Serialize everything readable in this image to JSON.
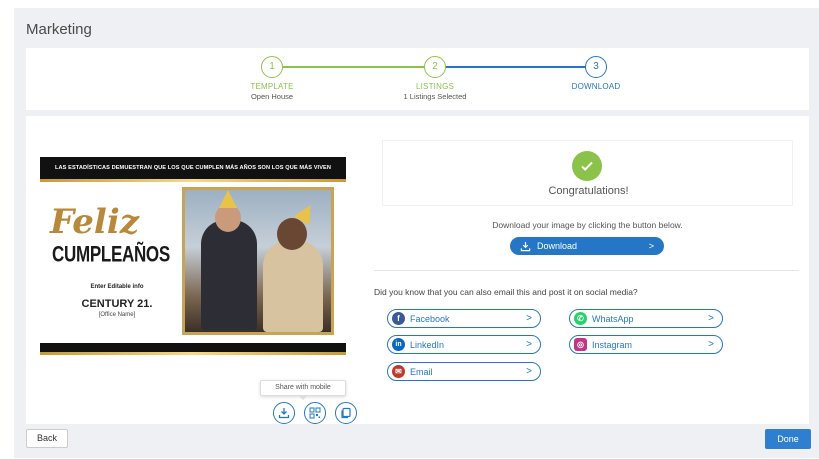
{
  "page": {
    "title": "Marketing"
  },
  "stepper": {
    "steps": [
      {
        "number": "1",
        "label": "TEMPLATE",
        "sub": "Open House"
      },
      {
        "number": "2",
        "label": "LISTINGS",
        "sub": "1 Listings Selected"
      },
      {
        "number": "3",
        "label": "DOWNLOAD",
        "sub": ""
      }
    ],
    "colors": {
      "done": "#8bc34a",
      "active": "#2577c6"
    }
  },
  "preview": {
    "banner": "LAS ESTADÍSTICAS DEMUESTRAN QUE LOS QUE CUMPLEN MÁS AÑOS  SON LOS QUE MÁS VIVEN",
    "headline_1": "Feliz",
    "headline_2": "CUMPLEAÑOS",
    "editable": "Enter Editable info",
    "brand": "CENTURY 21.",
    "office": "[Office Name]",
    "tooltip": "Share with mobile",
    "icons": [
      "download-icon",
      "qr-code-icon",
      "copy-icon"
    ]
  },
  "success": {
    "message": "Congratulations!",
    "instruction": "Download your image by clicking the button below.",
    "download_label": "Download"
  },
  "social": {
    "question": "Did you know that you can also email this and post it on social media?",
    "buttons": [
      {
        "label": "Facebook",
        "icon": "facebook-icon",
        "color": "#3b5998"
      },
      {
        "label": "WhatsApp",
        "icon": "whatsapp-icon",
        "color": "#25d366"
      },
      {
        "label": "LinkedIn",
        "icon": "linkedin-icon",
        "color": "#0a66c2"
      },
      {
        "label": "Instagram",
        "icon": "instagram-icon",
        "color": "#c13584"
      },
      {
        "label": "Email",
        "icon": "email-icon",
        "color": "#c0392b"
      }
    ]
  },
  "footer": {
    "back_label": "Back",
    "done_label": "Done"
  }
}
